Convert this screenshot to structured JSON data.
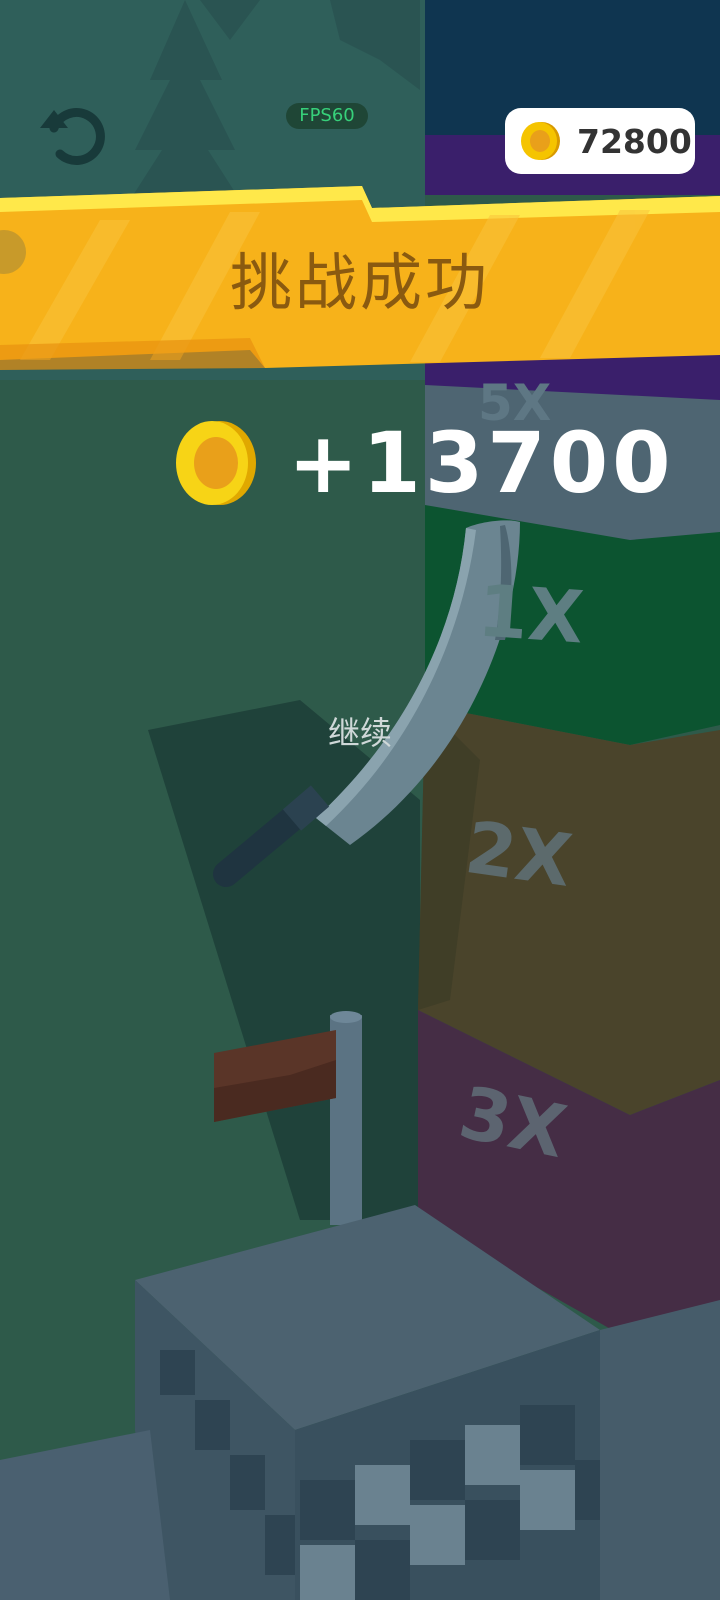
{
  "hud": {
    "fps_label": "FPS60",
    "coin_total": "72800",
    "restart_icon": "restart-icon"
  },
  "banner": {
    "title": "挑战成功"
  },
  "reward": {
    "amount": "+13700",
    "coin_icon": "coin-icon"
  },
  "actions": {
    "continue_label": "继续"
  },
  "tower": {
    "multipliers": [
      "1X",
      "2X",
      "3X"
    ]
  },
  "colors": {
    "banner": "#f7b21a",
    "coin": "#f5c400",
    "fps": "#37d07a"
  }
}
